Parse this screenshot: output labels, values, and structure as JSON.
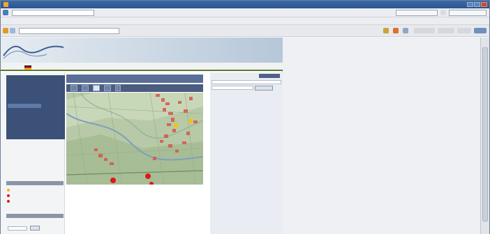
{
  "browser": {
    "title": "",
    "address": "",
    "menu": [
      "",
      "",
      "",
      "",
      ""
    ],
    "toolbar_url": ""
  },
  "page": {
    "banner_title": "",
    "nav": [
      "",
      "",
      "",
      ""
    ],
    "sidebar": {
      "menu_items": [
        "",
        "",
        "",
        "",
        "",
        "",
        "",
        "",
        "",
        "",
        "",
        "",
        "",
        ""
      ],
      "section1": "",
      "legend": [
        "",
        "",
        ""
      ],
      "section2": "",
      "link1": "",
      "button1": "",
      "link2": ""
    },
    "map": {
      "title": "",
      "markers_red": 3,
      "markers_yellow": 2
    },
    "search": {
      "label": "",
      "field": "",
      "button": "",
      "link": ""
    }
  },
  "colors": {
    "titlebar": "#2a5491",
    "sidebar_menu": "#3c5177",
    "map_header": "#5a6f97",
    "map_base": "#b7c9a6",
    "marker_red": "#e01818",
    "marker_yellow": "#f6c400"
  },
  "icons": [
    "app-icon",
    "back-arrow-icon",
    "forward-arrow-icon",
    "pan-tool-icon",
    "zoom-in-icon",
    "zoom-out-icon",
    "search-icon",
    "flag-icon"
  ]
}
